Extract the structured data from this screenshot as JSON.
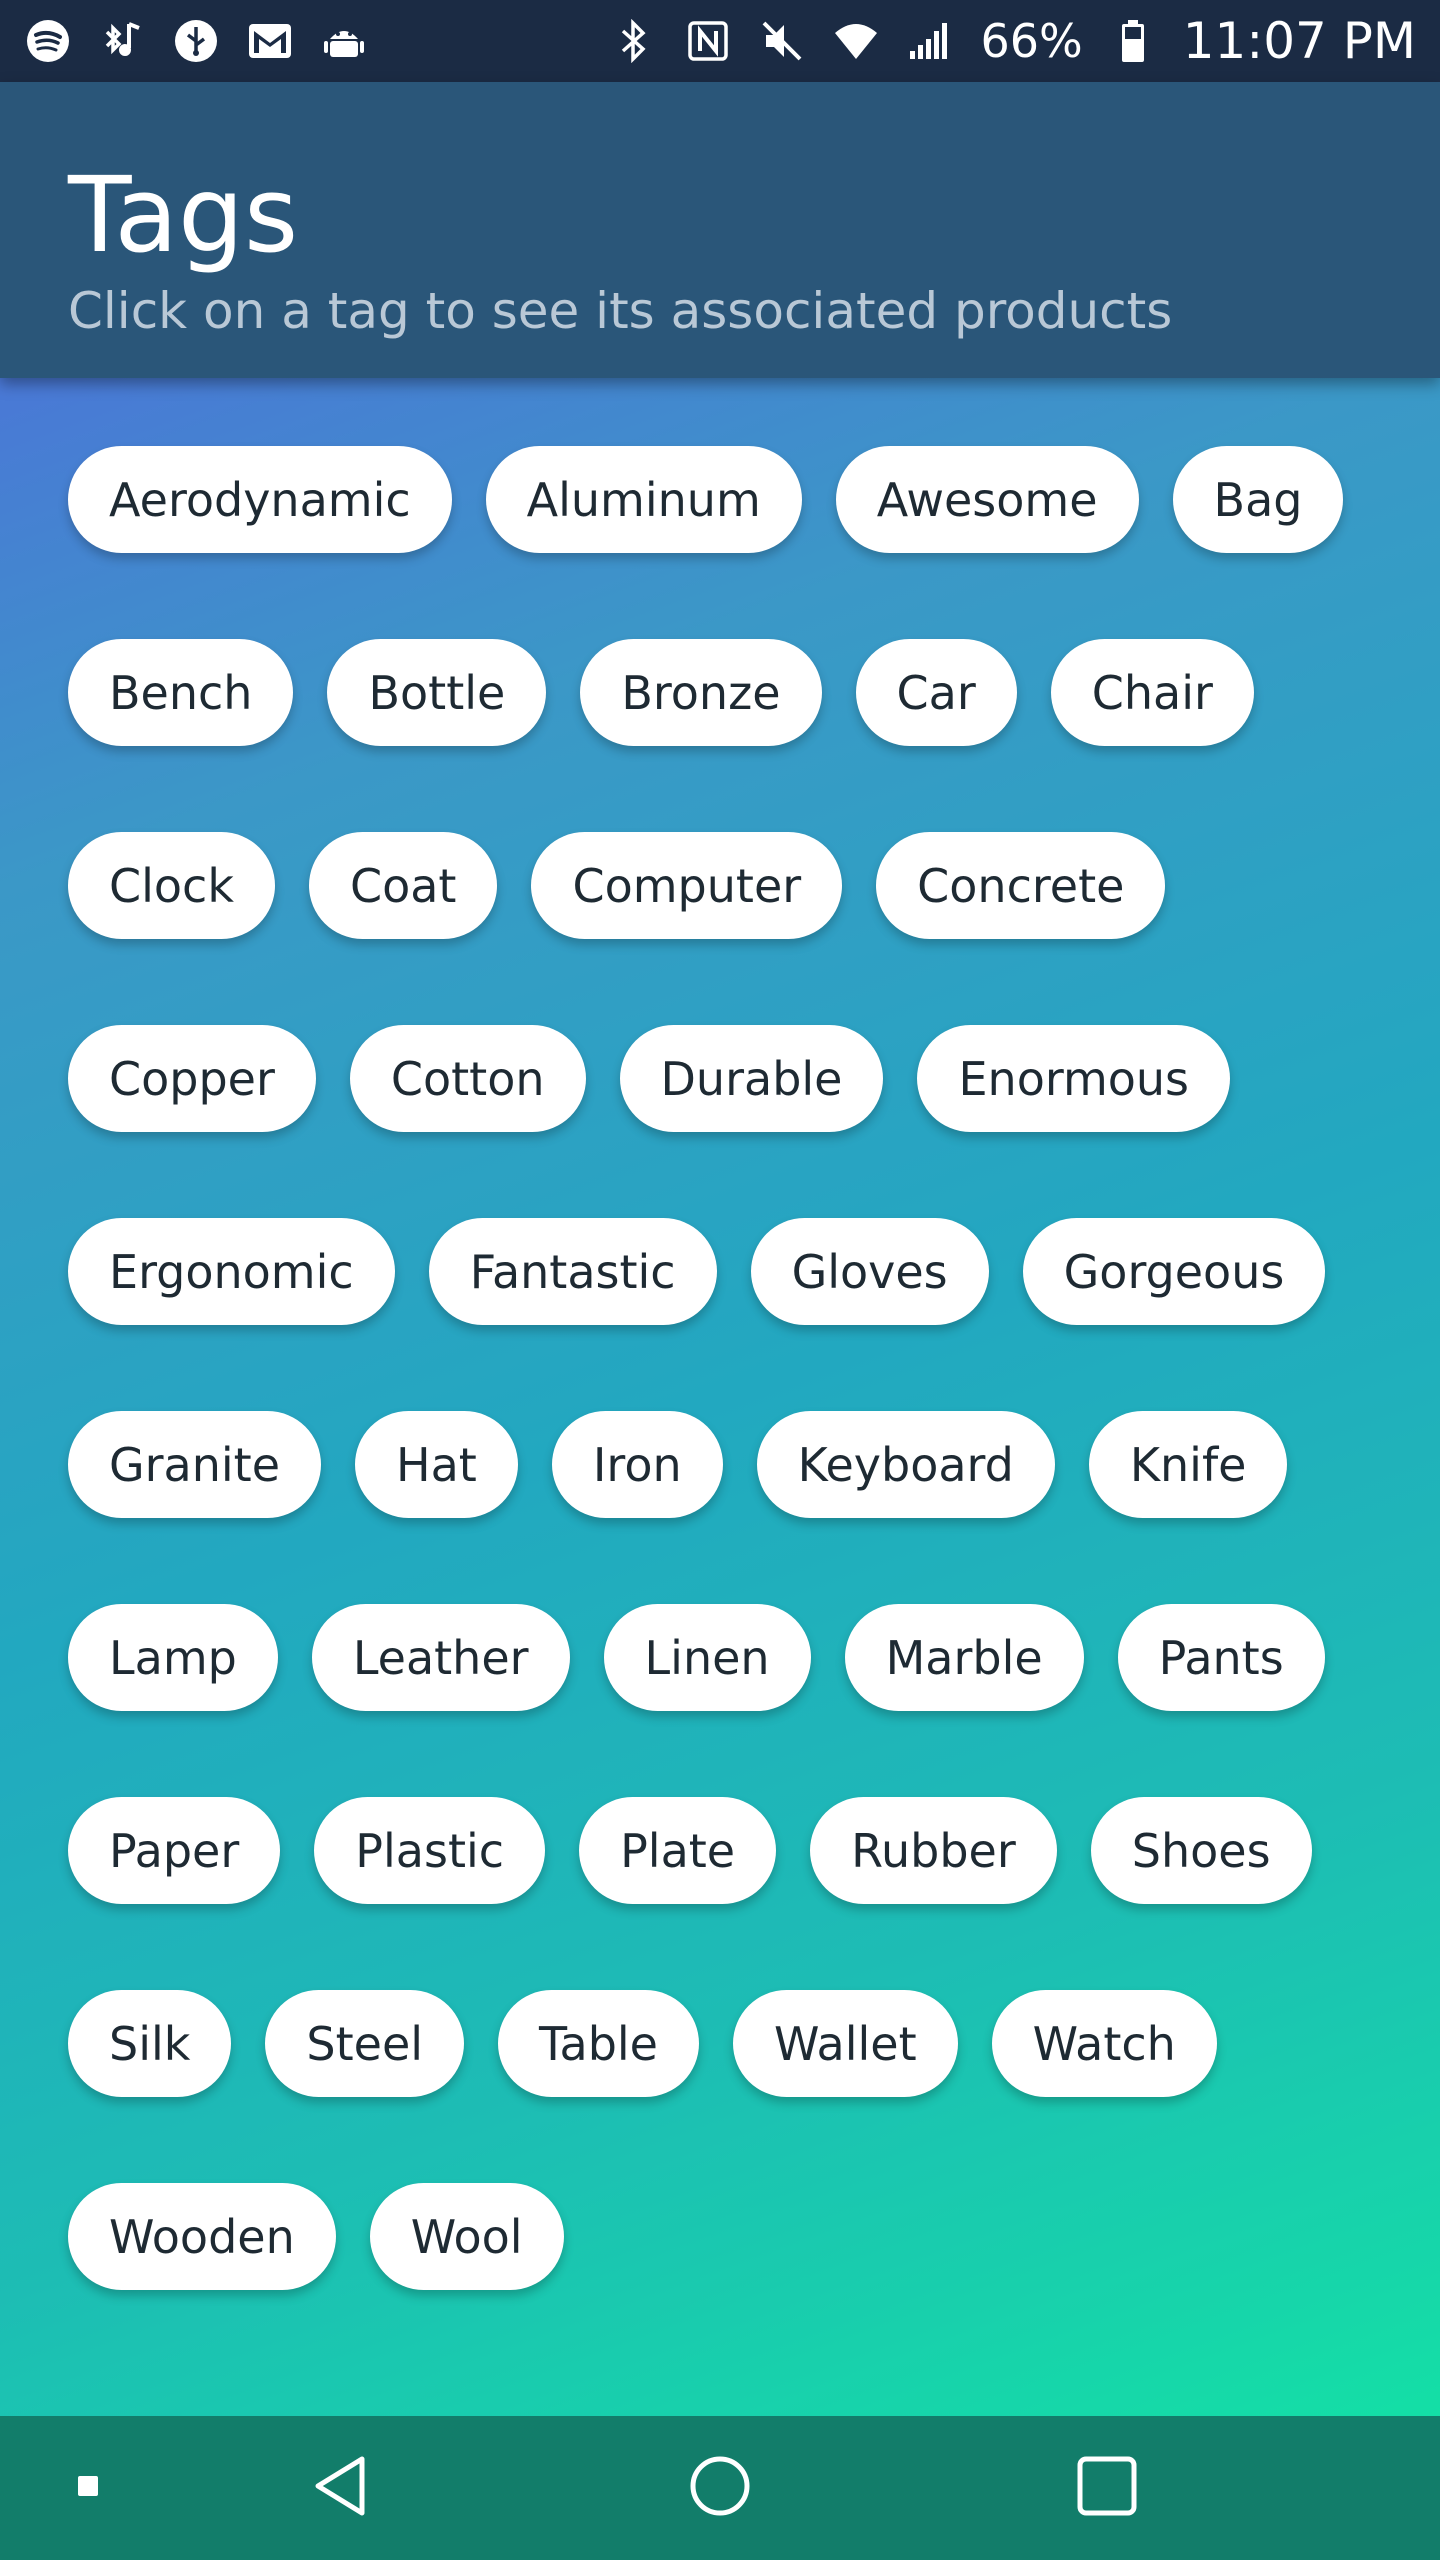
{
  "status_bar": {
    "left_icons": [
      "spotify-icon",
      "bluetooth-audio-icon",
      "usb-icon",
      "gmail-icon",
      "android-debug-icon"
    ],
    "right_icons": [
      "bluetooth-icon",
      "nfc-icon",
      "mute-icon",
      "wifi-icon",
      "signal-icon",
      "battery-icon"
    ],
    "battery": "66%",
    "time": "11:07 PM"
  },
  "header": {
    "title": "Tags",
    "subtitle": "Click on a tag to see its associated products"
  },
  "tags": [
    "Aerodynamic",
    "Aluminum",
    "Awesome",
    "Bag",
    "Bench",
    "Bottle",
    "Bronze",
    "Car",
    "Chair",
    "Clock",
    "Coat",
    "Computer",
    "Concrete",
    "Copper",
    "Cotton",
    "Durable",
    "Enormous",
    "Ergonomic",
    "Fantastic",
    "Gloves",
    "Gorgeous",
    "Granite",
    "Hat",
    "Iron",
    "Keyboard",
    "Knife",
    "Lamp",
    "Leather",
    "Linen",
    "Marble",
    "Pants",
    "Paper",
    "Plastic",
    "Plate",
    "Rubber",
    "Shoes",
    "Silk",
    "Steel",
    "Table",
    "Wallet",
    "Watch",
    "Wooden",
    "Wool"
  ],
  "nav_bar": {
    "buttons": [
      "menu-dot-icon",
      "back-icon",
      "home-icon",
      "recents-icon"
    ]
  },
  "colors": {
    "status_bar": "#1b2b44",
    "header": "#2a5679",
    "gradient_start": "#4a78d6",
    "gradient_end": "#14dfa6",
    "nav_bar": "#127d6a",
    "tag_background": "#ffffff",
    "tag_text": "#1e2a33"
  }
}
